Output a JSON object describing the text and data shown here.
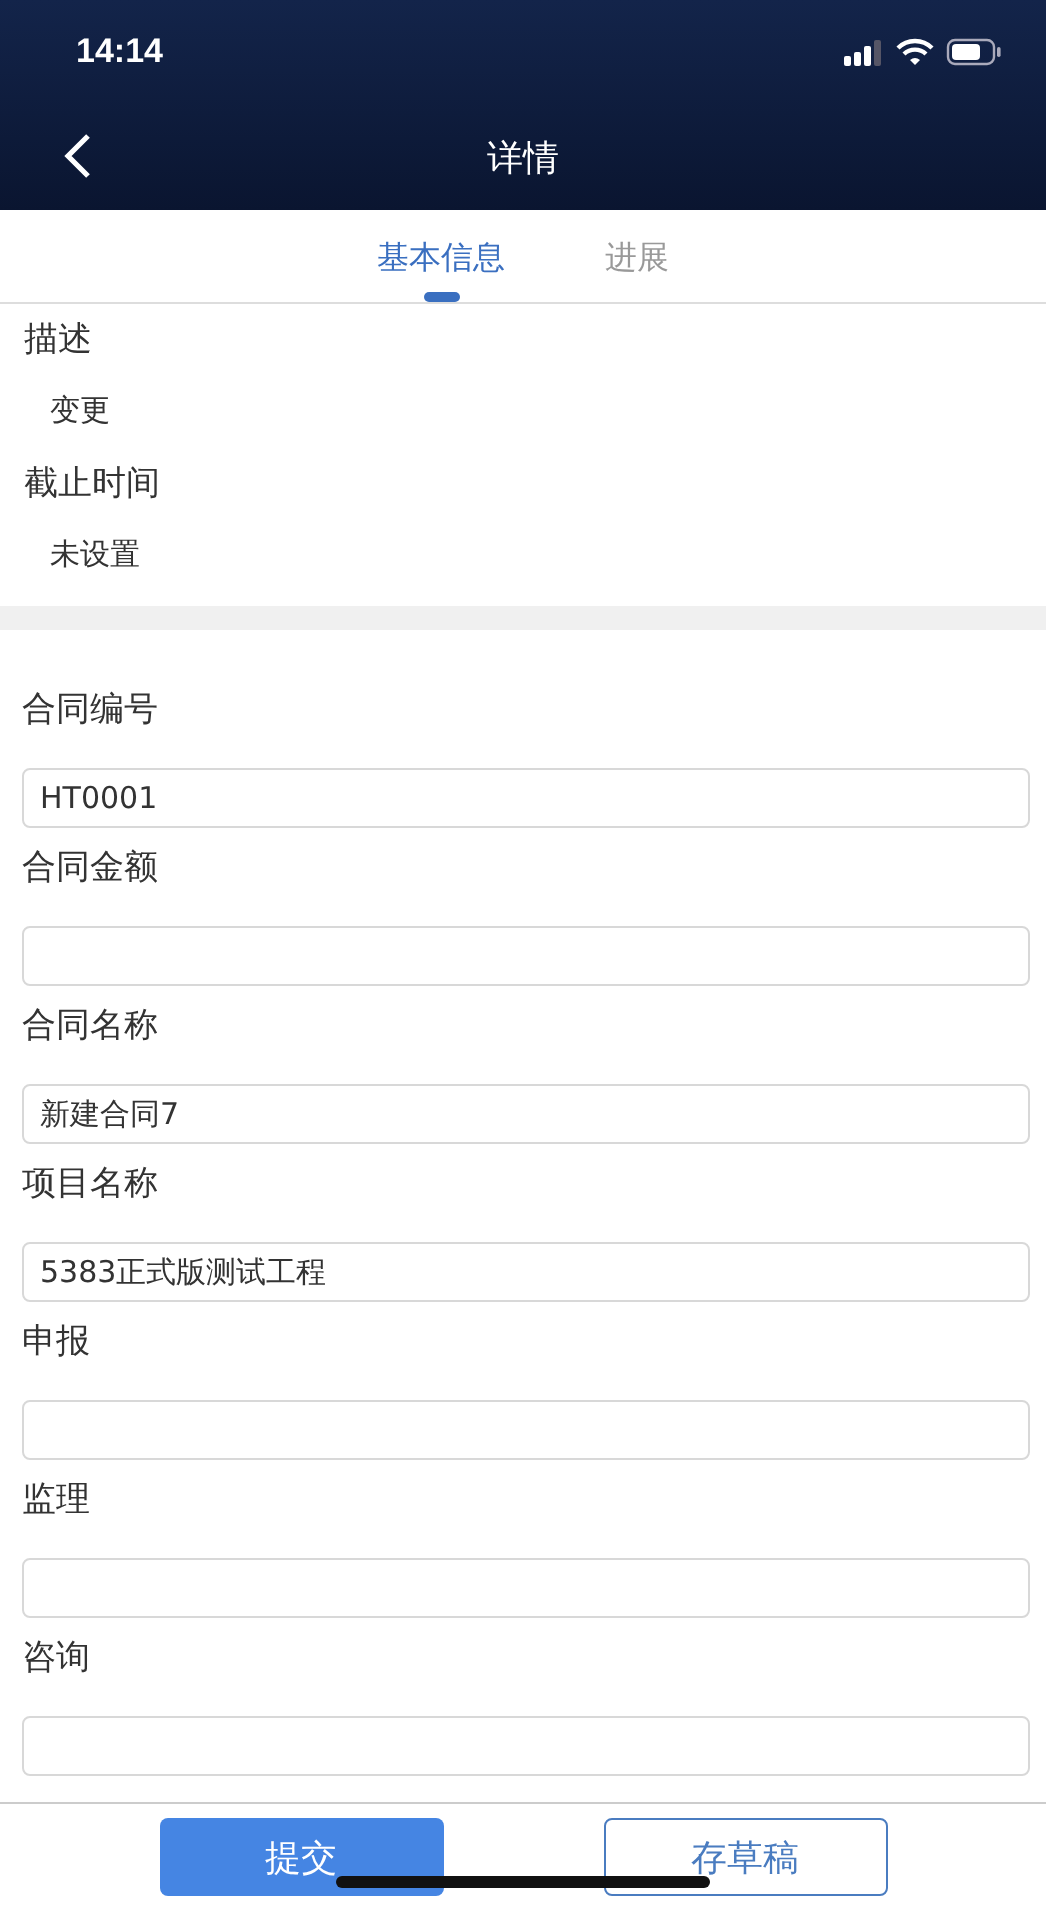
{
  "status_bar": {
    "time": "14:14"
  },
  "nav": {
    "title": "详情"
  },
  "tabs": [
    {
      "label": "基本信息",
      "selected": true
    },
    {
      "label": "进展",
      "selected": false
    }
  ],
  "info": [
    {
      "label": "描述",
      "value": "变更"
    },
    {
      "label": "截止时间",
      "value": "未设置"
    }
  ],
  "fields": [
    {
      "label": "合同编号",
      "value": "HT0001"
    },
    {
      "label": "合同金额"
    },
    {
      "label": "合同名称",
      "value": "新建合同7"
    },
    {
      "label": "项目名称",
      "value": "5383正式版测试工程"
    },
    {
      "label": "申报"
    },
    {
      "label": "监理"
    },
    {
      "label": "咨询"
    }
  ],
  "buttons": [
    {
      "label": "提交",
      "kind": "primary"
    },
    {
      "label": "存草稿",
      "kind": "outline"
    }
  ]
}
